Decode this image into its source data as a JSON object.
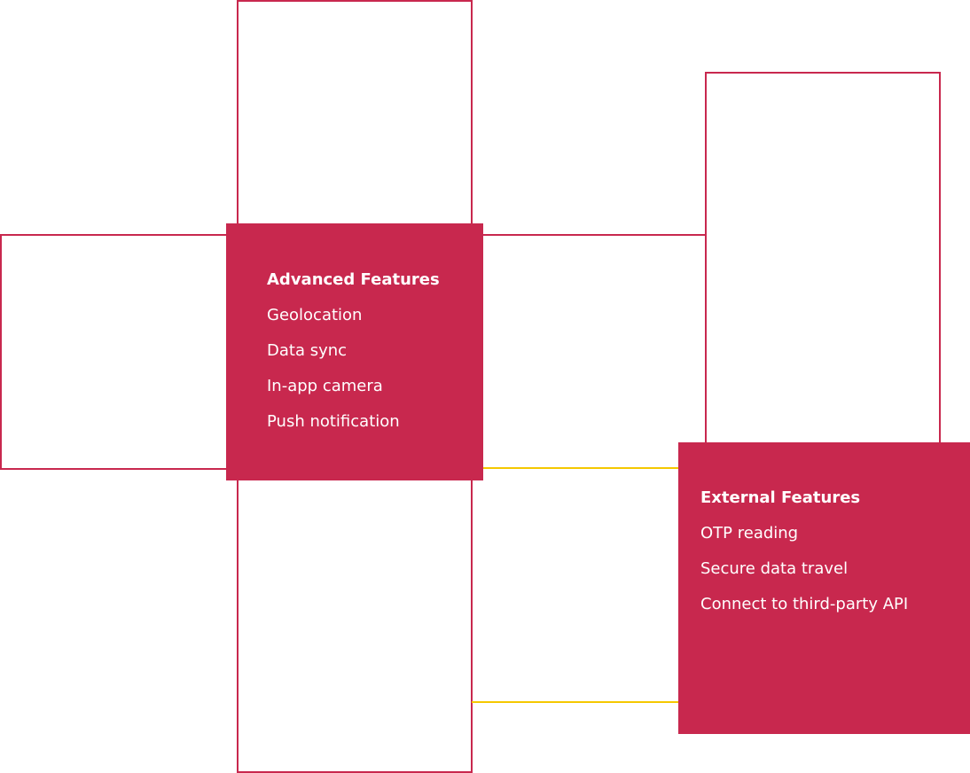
{
  "colors": {
    "accent": "#c8284e",
    "connector": "#f5c800"
  },
  "advanced": {
    "title": "Advanced Features",
    "items": [
      "Geolocation",
      "Data sync",
      "In-app camera",
      "Push notification"
    ]
  },
  "external": {
    "title": "External Features",
    "items": [
      "OTP reading",
      "Secure data travel",
      "Connect to third-party API"
    ]
  }
}
